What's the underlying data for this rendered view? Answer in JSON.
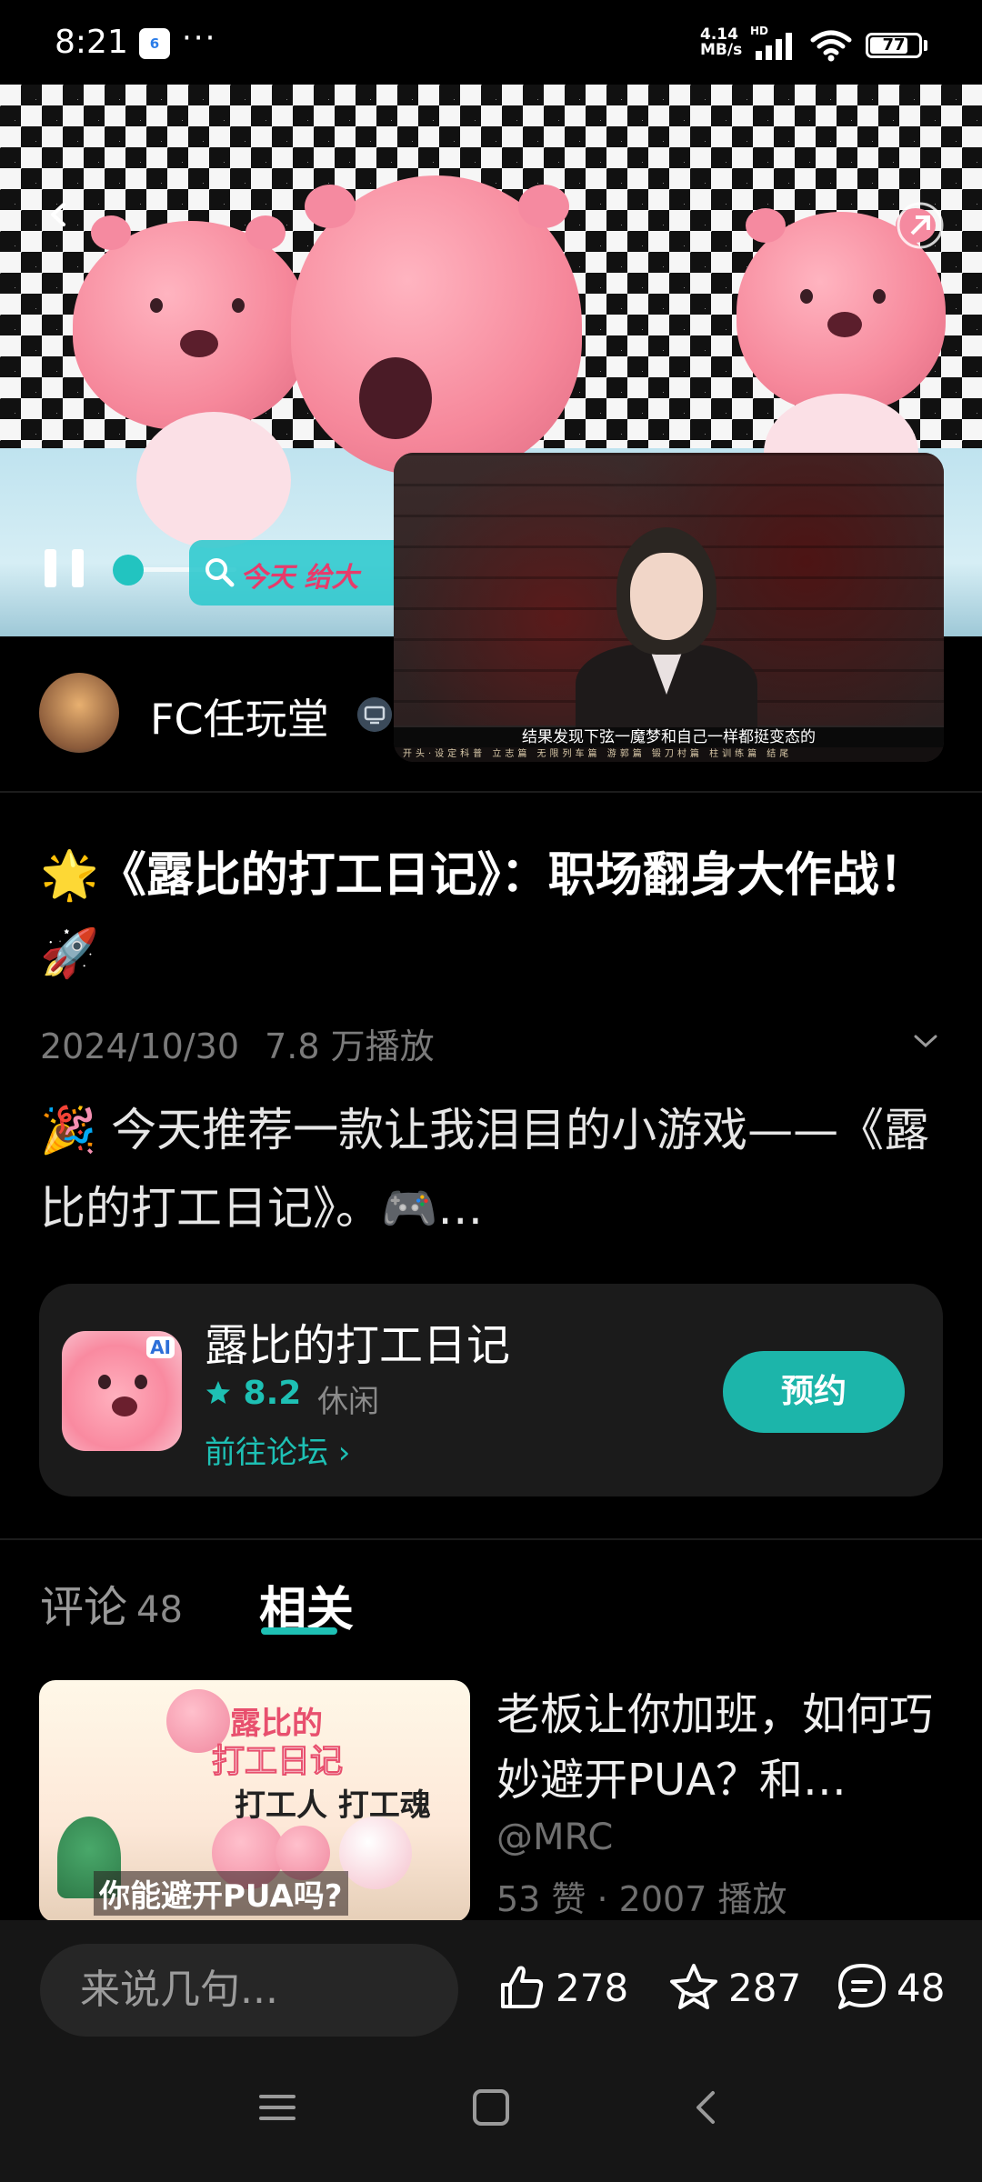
{
  "status_bar": {
    "time": "8:21",
    "app_icon_label": "6",
    "more": "···",
    "net_speed_value": "4.14",
    "net_speed_unit": "MB/s",
    "network_tag": "HD",
    "battery": "77"
  },
  "video": {
    "danmaku_text": "今天 给大",
    "mini_player_subtitle": "结果发现下弦一魔梦和自己一样都挺变态的",
    "mini_player_strip": "开头·设定科普 立志篇 无限列车篇 游郭篇 锻刀村篇 柱训练篇 结尾"
  },
  "channel": {
    "name": "FC任玩堂"
  },
  "post": {
    "title": "🌟《露比的打工日记》：职场翻身大作战！🚀",
    "date": "2024/10/30",
    "plays": "7.8 万播放",
    "description": "🎉 今天推荐一款让我泪目的小游戏——《露比的打工日记》。🎮…"
  },
  "game_card": {
    "name": "露比的打工日记",
    "ai_tag": "AI",
    "rating": "8.2",
    "genre": "休闲",
    "forum_link": "前往论坛 ›",
    "reserve_button": "预约"
  },
  "tabs": {
    "comments_label": "评论",
    "comments_count": "48",
    "related_label": "相关"
  },
  "related_item": {
    "thumb_line1": "露比的",
    "thumb_line2": "打工日记",
    "thumb_line3": "打工人 打工魂",
    "thumb_line4": "你能避开PUA吗?",
    "title": "老板让你加班，如何巧妙避开PUA？和…",
    "author": "@MRC",
    "stats": "53 赞 · 2007 播放"
  },
  "bottom_bar": {
    "comment_placeholder": "来说几句...",
    "likes": "278",
    "favorites": "287",
    "comments": "48"
  },
  "colors": {
    "accent": "#1ec0b4",
    "background": "#000000",
    "card": "#1b1b1b"
  }
}
